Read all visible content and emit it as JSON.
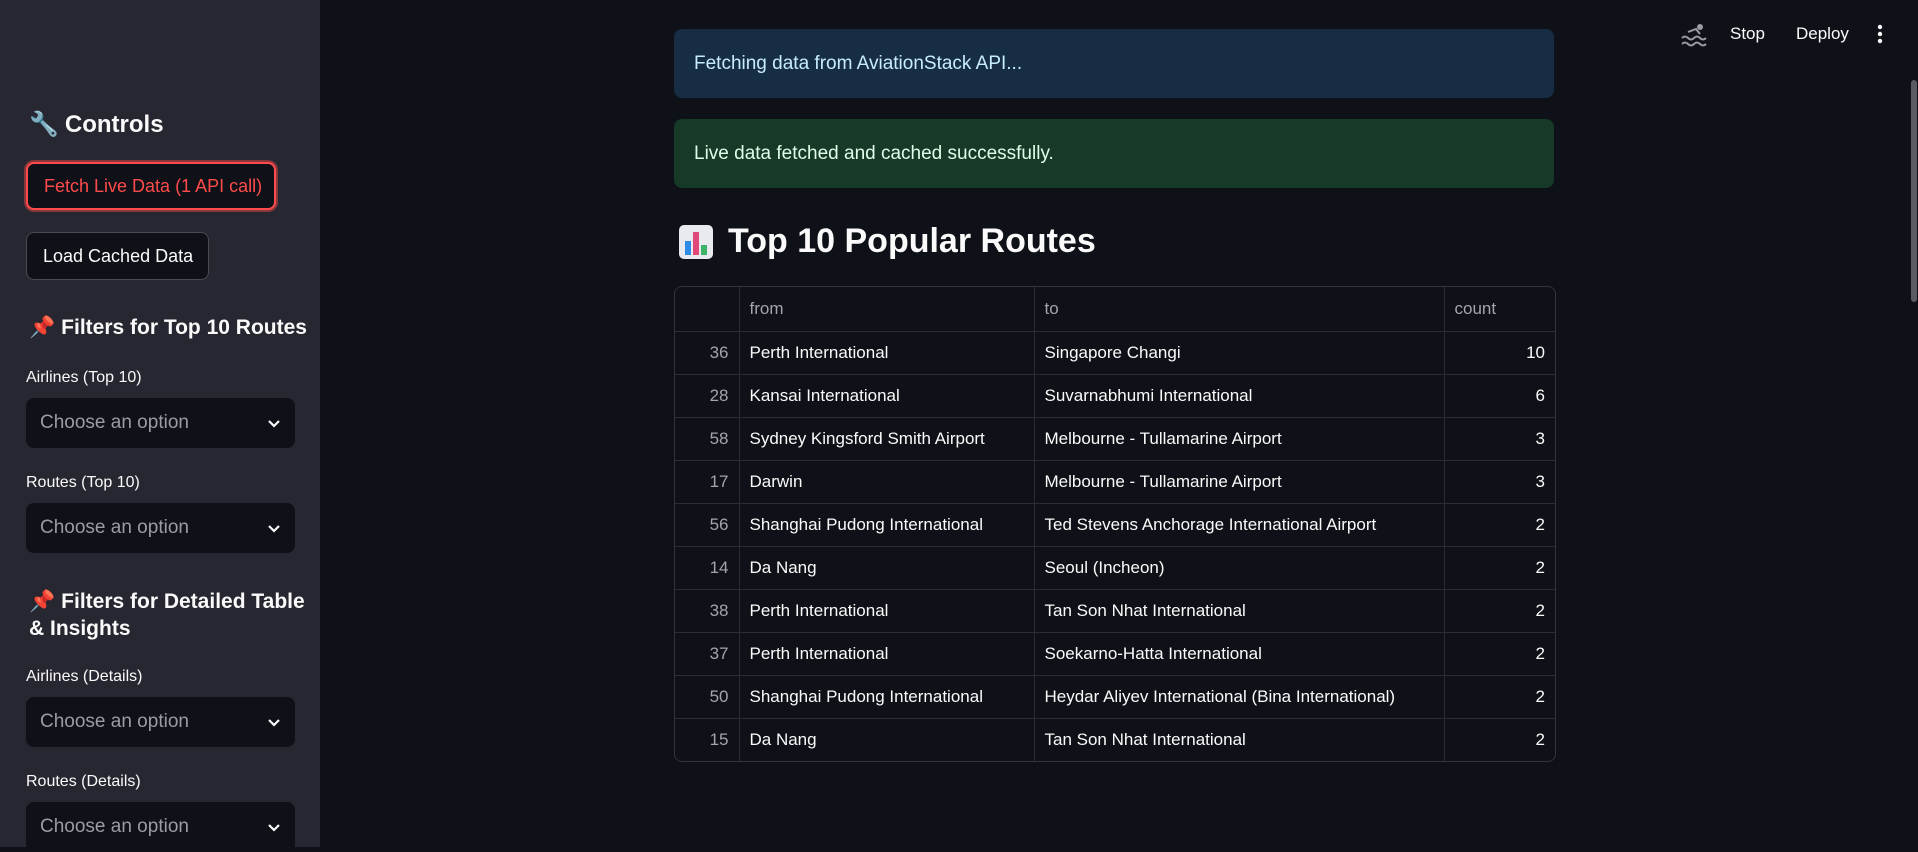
{
  "sidebar": {
    "controls_heading": "Controls",
    "controls_emoji": "🔧",
    "fetch_button": "Fetch Live Data (1 API call)",
    "load_button": "Load Cached Data",
    "filters_top_heading": "Filters for Top 10 Routes",
    "filters_detail_heading": "Filters for Detailed Table & Insights",
    "pin_emoji": "📌",
    "fields": [
      {
        "label": "Airlines (Top 10)",
        "placeholder": "Choose an option"
      },
      {
        "label": "Routes (Top 10)",
        "placeholder": "Choose an option"
      },
      {
        "label": "Airlines (Details)",
        "placeholder": "Choose an option"
      },
      {
        "label": "Routes (Details)",
        "placeholder": "Choose an option"
      }
    ]
  },
  "topbar": {
    "stop_label": "Stop",
    "deploy_label": "Deploy"
  },
  "alerts": {
    "info": "Fetching data from AviationStack API...",
    "success": "Live data fetched and cached successfully."
  },
  "section": {
    "title": "Top 10 Popular Routes"
  },
  "table": {
    "columns": [
      "",
      "from",
      "to",
      "count"
    ],
    "rows": [
      {
        "index": "36",
        "from": "Perth International",
        "to": "Singapore Changi",
        "count": "10"
      },
      {
        "index": "28",
        "from": "Kansai International",
        "to": "Suvarnabhumi International",
        "count": "6"
      },
      {
        "index": "58",
        "from": "Sydney Kingsford Smith Airport",
        "to": "Melbourne - Tullamarine Airport",
        "count": "3"
      },
      {
        "index": "17",
        "from": "Darwin",
        "to": "Melbourne - Tullamarine Airport",
        "count": "3"
      },
      {
        "index": "56",
        "from": "Shanghai Pudong International",
        "to": "Ted Stevens Anchorage International Airport",
        "count": "2"
      },
      {
        "index": "14",
        "from": "Da Nang",
        "to": "Seoul (Incheon)",
        "count": "2"
      },
      {
        "index": "38",
        "from": "Perth International",
        "to": "Tan Son Nhat International",
        "count": "2"
      },
      {
        "index": "37",
        "from": "Perth International",
        "to": "Soekarno-Hatta International",
        "count": "2"
      },
      {
        "index": "50",
        "from": "Shanghai Pudong International",
        "to": "Heydar Aliyev International (Bina International)",
        "count": "2"
      },
      {
        "index": "15",
        "from": "Da Nang",
        "to": "Tan Son Nhat International",
        "count": "2"
      }
    ]
  },
  "colors": {
    "primary": "#ff4b4b",
    "background": "#0e1117",
    "sidebar": "#262730",
    "info_bg": "#172d43",
    "success_bg": "#173928"
  },
  "icons": {
    "controls": "wrench-icon",
    "filters": "pushpin-icon",
    "section": "bar-chart-icon",
    "running": "swimmer-icon",
    "menu": "kebab-menu-icon",
    "dropdown": "chevron-down-icon"
  }
}
